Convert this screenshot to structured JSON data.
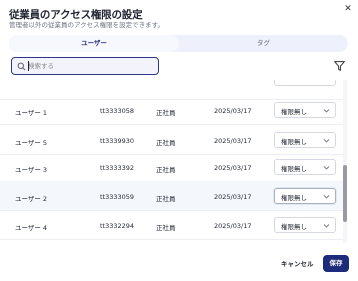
{
  "dialog": {
    "title": "従業員のアクセス権限の設定",
    "subtitle": "管理者以外の従業員のアクセス権限を設定できます。",
    "close_icon": "close-icon"
  },
  "tabs": [
    {
      "label": "ユーザー",
      "active": true
    },
    {
      "label": "タグ",
      "active": false
    }
  ],
  "search": {
    "placeholder": "検索する",
    "value": "",
    "icon": "search-icon"
  },
  "filter": {
    "icon": "filter-icon"
  },
  "rows": [
    {
      "name": "",
      "id": "",
      "type": "",
      "date": "",
      "permission": ""
    },
    {
      "name": "ユーザー 1",
      "id": "tt3333058",
      "type": "正社員",
      "date": "2025/03/17",
      "permission": "権限無し"
    },
    {
      "name": "ユーザー 5",
      "id": "tt3339930",
      "type": "正社員",
      "date": "2025/03/17",
      "permission": "権限無し"
    },
    {
      "name": "ユーザー 3",
      "id": "tt3333392",
      "type": "正社員",
      "date": "2025/03/17",
      "permission": "権限無し"
    },
    {
      "name": "ユーザー 2",
      "id": "tt3333059",
      "type": "正社員",
      "date": "2025/03/17",
      "permission": "権限無し"
    },
    {
      "name": "ユーザー 4",
      "id": "tt3332294",
      "type": "正社員",
      "date": "2025/03/17",
      "permission": "権限無し"
    },
    {
      "name": "",
      "id": "",
      "type": "",
      "date": "",
      "permission": ""
    }
  ],
  "scrollbar": {
    "position": 0.8,
    "visible_fraction": 0.35
  },
  "footer": {
    "cancel_label": "キャンセル",
    "save_label": "保存"
  },
  "colors": {
    "primary": "#1e2a7a",
    "tab_bg": "#eef0fb",
    "highlight_row": "#f4f7fb"
  }
}
